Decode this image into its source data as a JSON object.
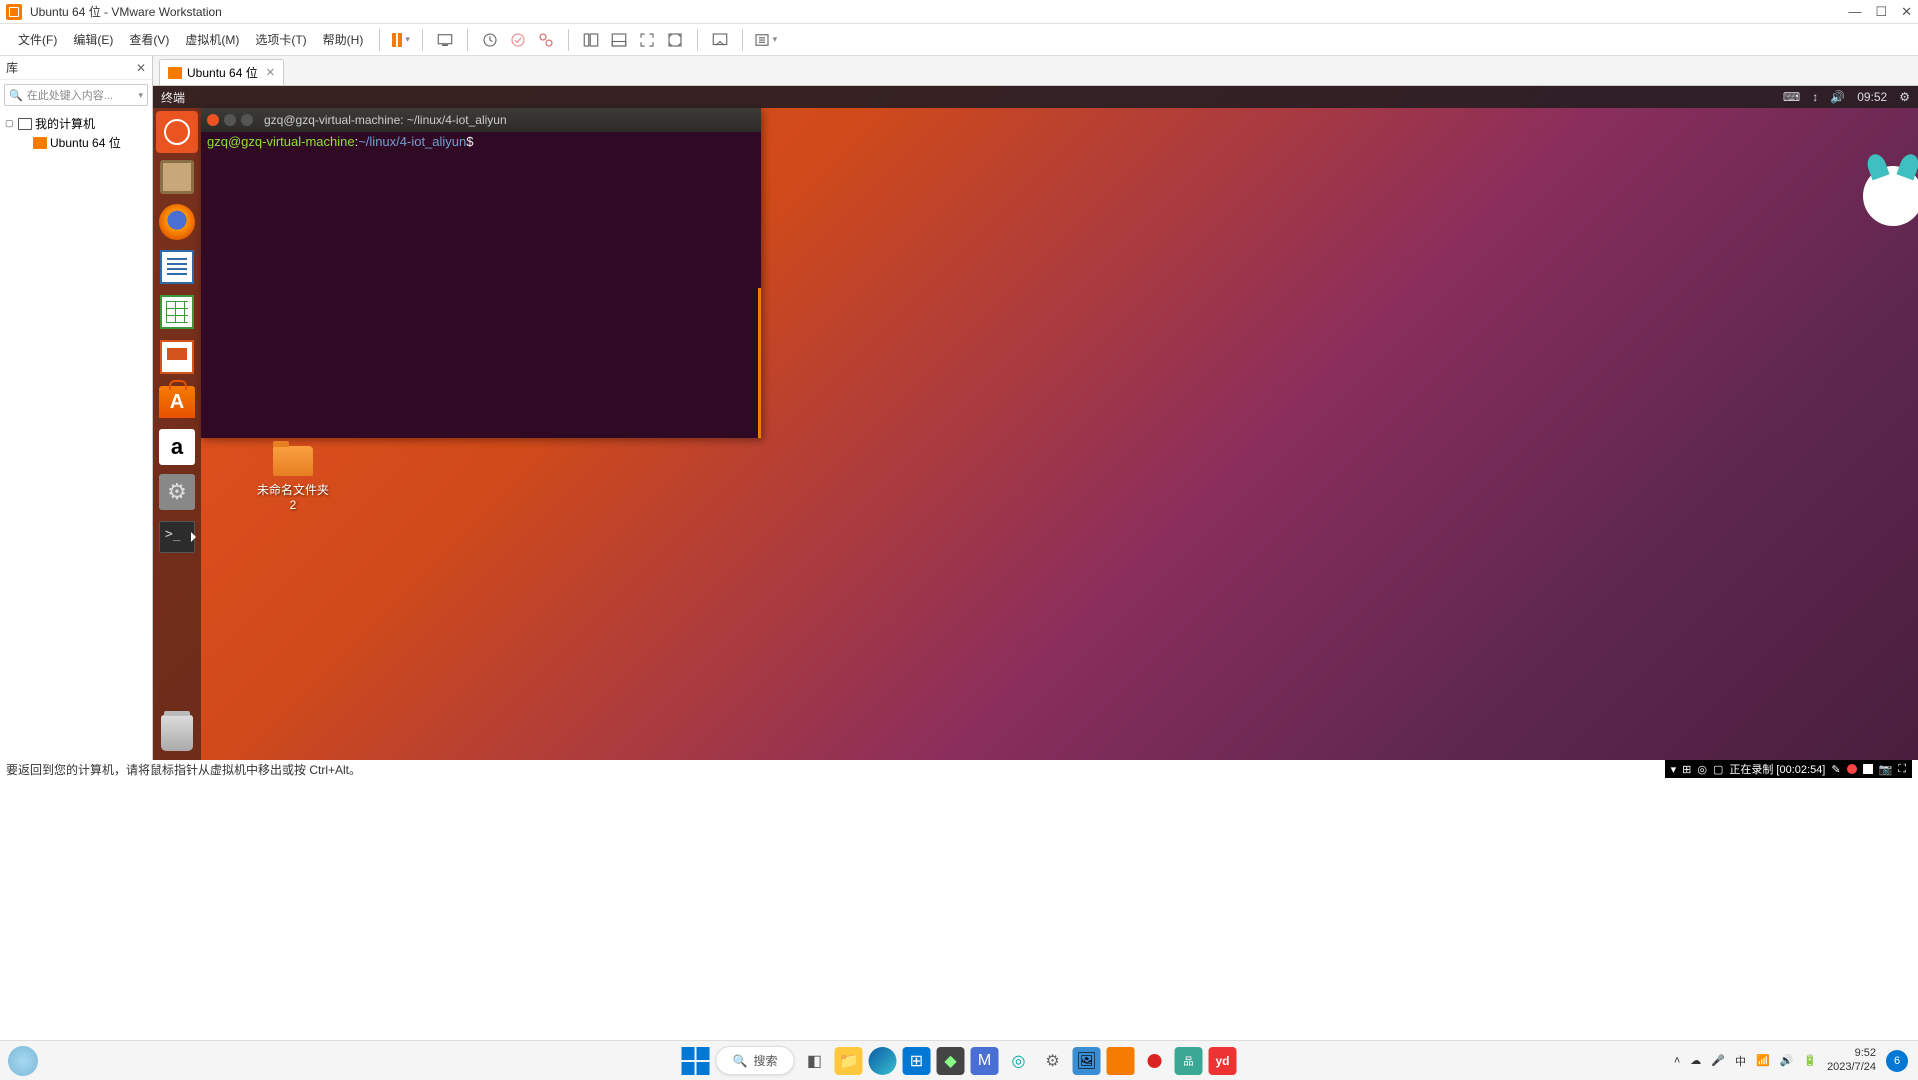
{
  "titlebar": {
    "title": "Ubuntu 64 位 - VMware Workstation"
  },
  "menubar": {
    "items": [
      "文件(F)",
      "编辑(E)",
      "查看(V)",
      "虚拟机(M)",
      "选项卡(T)",
      "帮助(H)"
    ]
  },
  "library": {
    "header": "库",
    "search_placeholder": "在此处键入内容...",
    "root": "我的计算机",
    "child": "Ubuntu 64 位"
  },
  "tab": {
    "label": "Ubuntu 64 位"
  },
  "ubuntu_top": {
    "app_label": "终端",
    "time": "09:52"
  },
  "terminal": {
    "title": "gzq@gzq-virtual-machine: ~/linux/4-iot_aliyun",
    "prompt_user": "gzq@gzq-virtual-machine",
    "prompt_colon": ":",
    "prompt_path": "~/linux/4-iot_aliyun",
    "prompt_dollar": "$"
  },
  "desktop": {
    "folder_name": "未命名文件夹 2"
  },
  "statusbar": {
    "hint": "要返回到您的计算机，请将鼠标指针从虚拟机中移出或按 Ctrl+Alt。",
    "recording": "正在录制 [00:02:54]"
  },
  "search": {
    "label": "搜索"
  },
  "ime": {
    "label": "中"
  },
  "clock": {
    "time": "9:52",
    "date": "2023/7/24"
  },
  "notif": {
    "count": "6"
  },
  "amazon": {
    "letter": "a"
  }
}
